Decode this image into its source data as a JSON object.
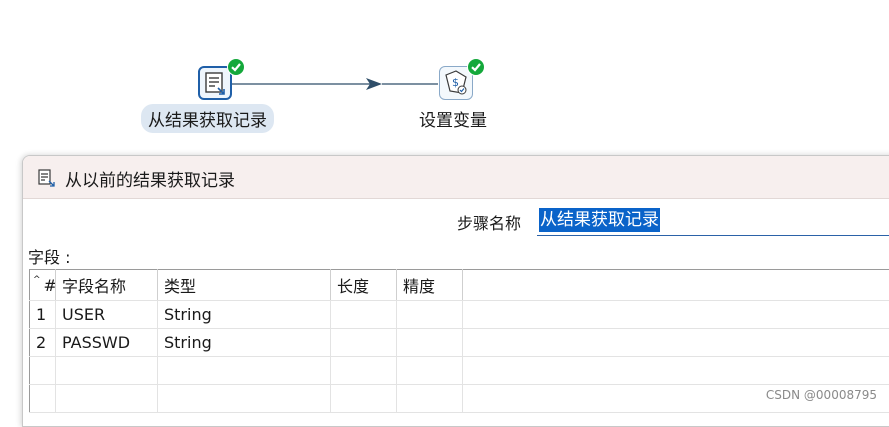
{
  "graph": {
    "step1": {
      "label": "从结果获取记录",
      "icon": "get-rows-from-result-icon",
      "status": "ok"
    },
    "step2": {
      "label": "设置变量",
      "icon": "set-variables-icon",
      "status": "ok"
    },
    "hop": {
      "from": "从结果获取记录",
      "to": "设置变量"
    }
  },
  "dialog": {
    "title": "从以前的结果获取记录",
    "title_icon": "get-rows-from-result-icon",
    "stepname_label": "步骤名称",
    "stepname_value": "从结果获取记录",
    "fields_label": "字段 :",
    "table": {
      "headers": [
        "#",
        "字段名称",
        "类型",
        "长度",
        "精度"
      ],
      "rows": [
        [
          "1",
          "USER",
          "String",
          "",
          ""
        ],
        [
          "2",
          "PASSWD",
          "String",
          "",
          ""
        ],
        [
          "",
          "",
          "",
          "",
          ""
        ],
        [
          "",
          "",
          "",
          "",
          ""
        ]
      ]
    }
  },
  "watermark": "CSDN @00008795",
  "colors": {
    "accent": "#0a63c9",
    "success": "#14a83b",
    "hop": "#2f4e69",
    "title_bg": "#f7efee"
  }
}
